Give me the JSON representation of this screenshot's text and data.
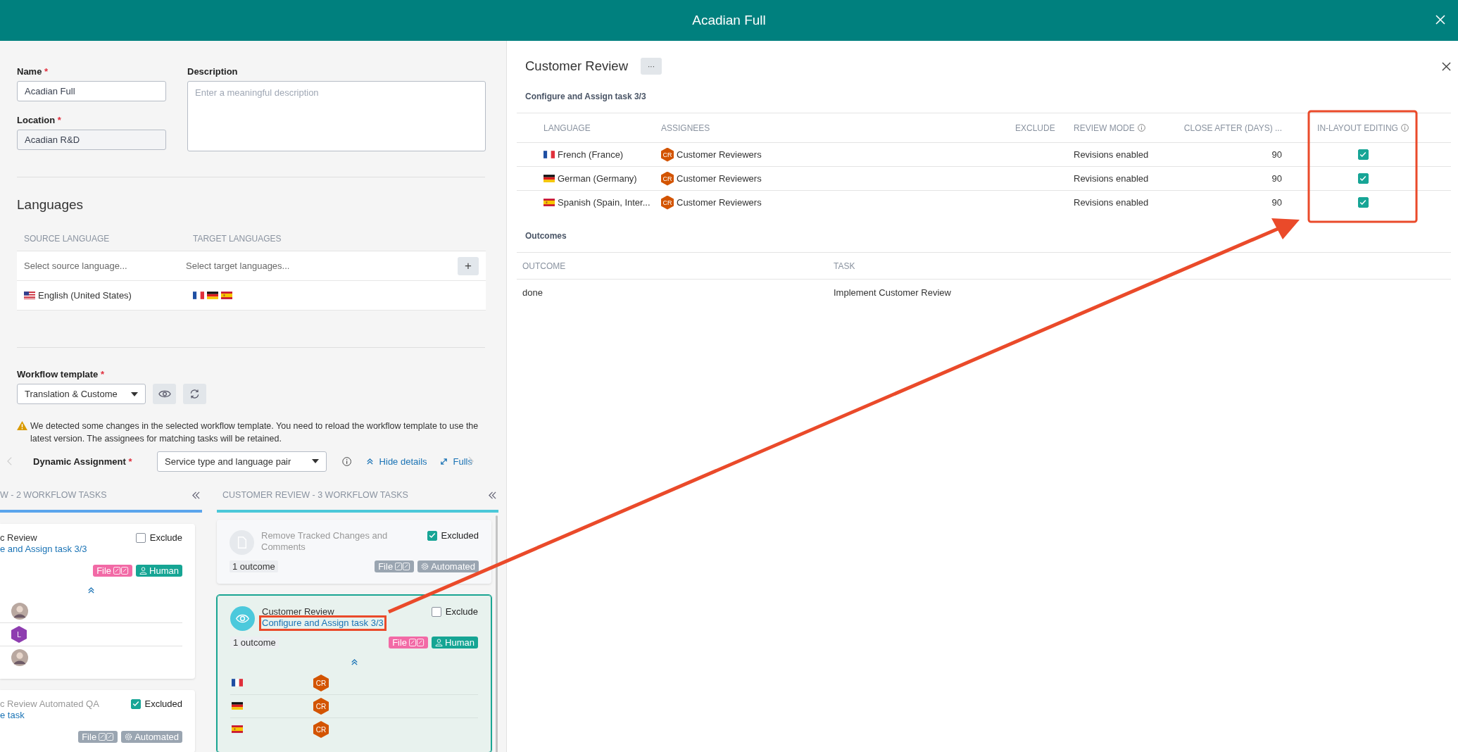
{
  "window": {
    "title": "Acadian Full"
  },
  "form": {
    "fields": [
      {
        "label": "Name",
        "required_mark": "*",
        "value": "Acadian Full"
      },
      {
        "label": "Location",
        "required_mark": "*",
        "value": "Acadian R&D"
      }
    ],
    "description": {
      "label": "Description",
      "placeholder": "Enter a meaningful description"
    }
  },
  "languages": {
    "title": "Languages",
    "columns": [
      "SOURCE LANGUAGE",
      "TARGET LANGUAGES"
    ],
    "source_placeholder": "Select source language...",
    "target_placeholder": "Select target languages...",
    "add_button": "+",
    "rows": [
      {
        "source": {
          "kind": "us",
          "name": "English (United States)"
        },
        "targets": [
          {
            "kind": "fr"
          },
          {
            "kind": "de"
          },
          {
            "kind": "es"
          }
        ]
      }
    ]
  },
  "workflow": {
    "label": "Workflow template",
    "required_mark": "*",
    "value": "Translation & Custome",
    "warning": "We detected some changes in the selected workflow template. You need to reload the workflow template to use the latest version. The assignees for matching tasks will be retained.",
    "dynamic_label": "Dynamic Assignment",
    "dynamic_required_mark": "*",
    "dynamic_value": "Service type and language pair",
    "hide_details": "Hide details",
    "fullscreen": "Fulls"
  },
  "board": [
    {
      "title": "W - 2 WORKFLOW TASKS",
      "color": "#5aa5ec",
      "cards": [
        {
          "title": "c Review",
          "link": "e and Assign task 3/3",
          "exclude": {
            "label": "Exclude",
            "checked": false
          },
          "tags": [
            {
              "kind": "file",
              "label": "File",
              "color": "#f26aa6"
            },
            {
              "kind": "human",
              "label": "Human",
              "color": "#16a594"
            }
          ],
          "expanded": true,
          "selected": false,
          "assignments": [
            {
              "assignee": {
                "kind": "photo"
              }
            },
            {
              "assignee": {
                "kind": "initials",
                "text": "L",
                "color": "#8e3db0"
              }
            },
            {
              "assignee": {
                "kind": "photo"
              }
            }
          ]
        },
        {
          "title": "c Review Automated QA",
          "link": "e task",
          "exclude": {
            "label": "Excluded",
            "checked": true
          },
          "tags": [
            {
              "kind": "file",
              "label": "File",
              "color": "#9aa5b1"
            },
            {
              "kind": "automated",
              "label": "Automated",
              "color": "#9aa5b1"
            }
          ],
          "selected": false
        }
      ]
    },
    {
      "title": "CUSTOMER REVIEW - 3 WORKFLOW TASKS",
      "color": "#4bc8d8",
      "cards": [
        {
          "kind": "document",
          "title": "Remove Tracked Changes and Comments",
          "exclude": {
            "label": "Excluded",
            "checked": true
          },
          "outcome": "1 outcome",
          "tags": [
            {
              "kind": "file",
              "label": "File",
              "color": "#9aa5b1"
            },
            {
              "kind": "automated",
              "label": "Automated",
              "color": "#9aa5b1"
            }
          ],
          "selected": false
        },
        {
          "kind": "eye",
          "title": "Customer Review",
          "link": "Configure and Assign task 3/3",
          "exclude": {
            "label": "Exclude",
            "checked": false
          },
          "outcome": "1 outcome",
          "tags": [
            {
              "kind": "file",
              "label": "File",
              "color": "#f26aa6"
            },
            {
              "kind": "human",
              "label": "Human",
              "color": "#16a594"
            }
          ],
          "expanded": true,
          "selected": true,
          "highlighted": true,
          "assignments": [
            {
              "flag": {
                "kind": "fr"
              },
              "assignee": {
                "kind": "initials",
                "text": "CR",
                "color": "#d35400"
              }
            },
            {
              "flag": {
                "kind": "de"
              },
              "assignee": {
                "kind": "initials",
                "text": "CR",
                "color": "#d35400"
              }
            },
            {
              "flag": {
                "kind": "es"
              },
              "assignee": {
                "kind": "initials",
                "text": "CR",
                "color": "#d35400"
              }
            }
          ]
        }
      ]
    }
  ],
  "detail": {
    "title": "Customer Review",
    "more_button": "···",
    "section": "Configure and Assign task 3/3",
    "columns": [
      {
        "label": "LANGUAGE",
        "info": false
      },
      {
        "label": "ASSIGNEES",
        "info": false
      },
      {
        "label": "EXCLUDE",
        "info": false
      },
      {
        "label": "REVIEW MODE",
        "info": true
      },
      {
        "label": "CLOSE AFTER (DAYS) ...",
        "info": false
      },
      {
        "label": "IN-LAYOUT EDITING",
        "info": true
      }
    ],
    "rows": [
      {
        "flag": {
          "kind": "fr"
        },
        "language": "French (France)",
        "assignee": {
          "initials": "CR",
          "name": "Customer Reviewers",
          "color": "#d35400"
        },
        "review_mode": "Revisions enabled",
        "close_after": "90",
        "in_layout_editing": true
      },
      {
        "flag": {
          "kind": "de"
        },
        "language": "German (Germany)",
        "assignee": {
          "initials": "CR",
          "name": "Customer Reviewers",
          "color": "#d35400"
        },
        "review_mode": "Revisions enabled",
        "close_after": "90",
        "in_layout_editing": true
      },
      {
        "flag": {
          "kind": "es"
        },
        "language": "Spanish (Spain, Inter...",
        "assignee": {
          "initials": "CR",
          "name": "Customer Reviewers",
          "color": "#d35400"
        },
        "review_mode": "Revisions enabled",
        "close_after": "90",
        "in_layout_editing": true
      }
    ],
    "outcomes": {
      "title": "Outcomes",
      "columns": [
        "OUTCOME",
        "TASK"
      ],
      "rows": [
        {
          "outcome": "done",
          "task": "Implement Customer Review"
        }
      ]
    }
  }
}
